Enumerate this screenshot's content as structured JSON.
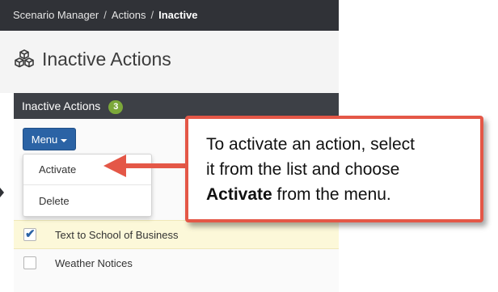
{
  "breadcrumb": {
    "items": [
      "Scenario Manager",
      "Actions"
    ],
    "separator": "/",
    "current": "Inactive"
  },
  "page": {
    "title": "Inactive Actions",
    "icon": "cubes-icon"
  },
  "panel": {
    "title": "Inactive Actions",
    "count": "3"
  },
  "menu": {
    "label": "Menu",
    "items": [
      "Activate",
      "Delete"
    ]
  },
  "rows": [
    {
      "label": "Text to School of Business",
      "checked": true
    },
    {
      "label": "Weather Notices",
      "checked": false
    }
  ],
  "callout": {
    "line1": "To activate an action, select",
    "line2": "it from the list and choose",
    "bold": "Activate",
    "line3_rest": " from the menu."
  },
  "colors": {
    "accent": "#2b63a5",
    "callout_border": "#e45747",
    "badge": "#7ca83a",
    "highlight_row": "#fcf8d9"
  }
}
